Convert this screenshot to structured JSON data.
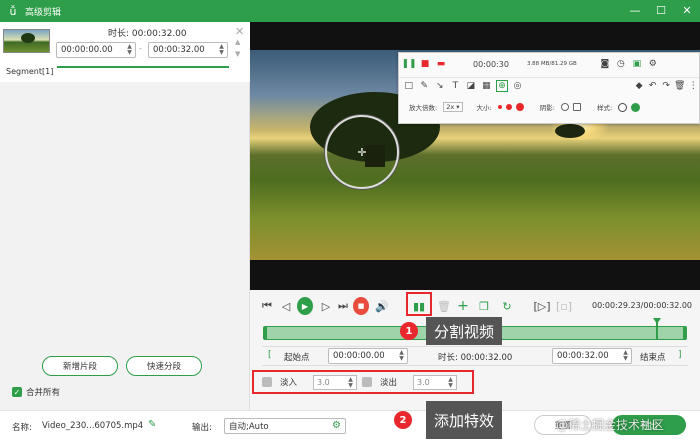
{
  "titlebar": {
    "title": "高级剪辑",
    "logo_icon": "rabbit-logo-icon",
    "min": "—",
    "max": "☐",
    "close": "✕"
  },
  "segment": {
    "duration_label": "时长: 00:00:32.00",
    "start": "00:00:00.00",
    "end": "00:00:32.00",
    "separator": "-",
    "label": "Segment[1]",
    "close": "✕"
  },
  "left_actions": {
    "new_segment": "新增片段",
    "quick_split": "快速分段",
    "merge_all": "合并所有"
  },
  "recorder": {
    "time": "00:00:30",
    "size": "3.88 MB/81.29 GB",
    "magnifier_label": "放大倍数:",
    "zoom_value": "2x",
    "size_label": "大小:",
    "shadow_label": "阴影:",
    "style_label": "样式:",
    "zoom_sep": "▾"
  },
  "controls": {
    "time_display": "00:00:29.23/00:00:32.00"
  },
  "range": {
    "start_point": "起始点",
    "start_time": "00:00:00.00",
    "duration": "时长: 00:00:32.00",
    "end_time": "00:00:32.00",
    "end_point": "结束点",
    "bracket_left": "[",
    "bracket_right": "]"
  },
  "effects": {
    "fade_in": "淡入",
    "fade_in_value": "3.0",
    "fade_out": "淡出",
    "fade_out_value": "3.0"
  },
  "callouts": [
    {
      "num": "1",
      "text": "分割视频"
    },
    {
      "num": "2",
      "text": "添加特效"
    }
  ],
  "bottom": {
    "name_label": "名称:",
    "name_value": "Video_230...60705.mp4",
    "output_label": "输出:",
    "output_value": "自动;Auto",
    "reset_button": "重置",
    "export_button": "导出",
    "watermark": "@稀土掘金技术社区"
  },
  "colors": {
    "accent": "#2e9e4a",
    "highlight": "#e8282d",
    "stop": "#e74c3c"
  }
}
